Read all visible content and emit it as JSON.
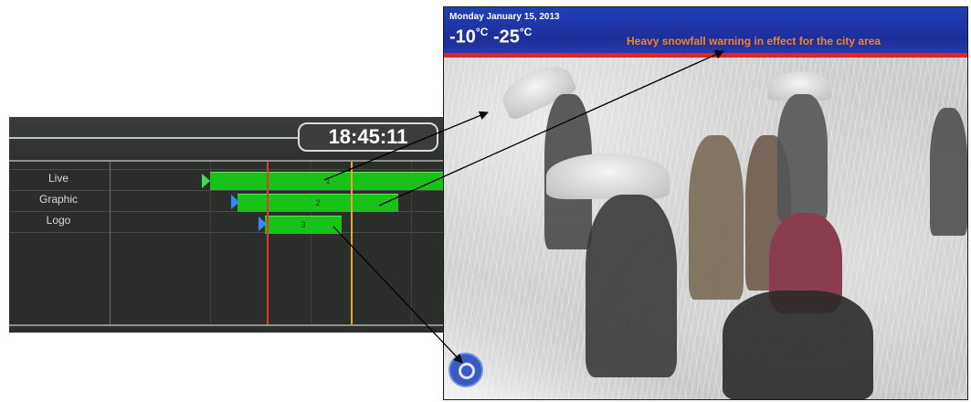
{
  "timeline": {
    "clock": "18:45:11",
    "tracks": [
      {
        "label": "Live"
      },
      {
        "label": "Graphic"
      },
      {
        "label": "Logo"
      }
    ],
    "clips": [
      {
        "track": "Live",
        "label": "1"
      },
      {
        "track": "Graphic",
        "label": "2"
      },
      {
        "track": "Logo",
        "label": "3"
      }
    ]
  },
  "preview": {
    "date": "Monday January 15, 2013",
    "temp_low": "-10",
    "temp_high": "-25",
    "temp_unit": "°C",
    "ticker": "Heavy snowfall warning in effect for the city area",
    "colors": {
      "header": "#1c2f99",
      "rule": "#e02424",
      "ticker": "#f2832d"
    }
  },
  "icons": [
    "station-logo-icon"
  ]
}
